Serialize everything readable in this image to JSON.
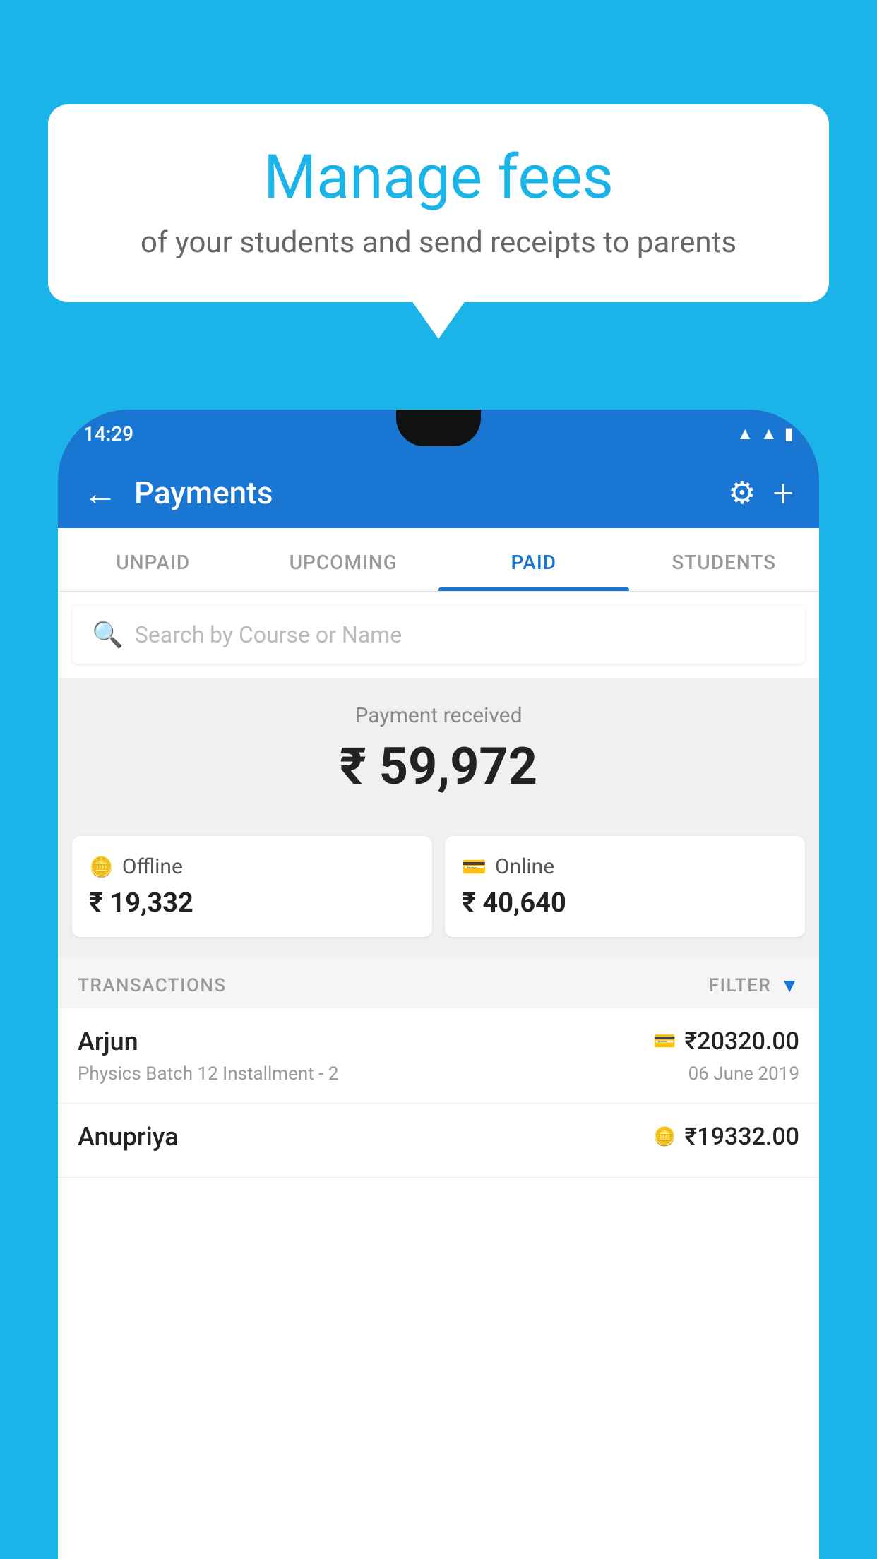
{
  "background_color": "#1ab4e8",
  "bubble": {
    "title": "Manage fees",
    "subtitle": "of your students and send receipts to parents"
  },
  "phone": {
    "status_bar": {
      "time": "14:29",
      "icons": [
        "wifi",
        "signal",
        "battery"
      ]
    },
    "header": {
      "title": "Payments",
      "back_label": "←",
      "gear_label": "⚙",
      "plus_label": "+"
    },
    "tabs": [
      {
        "label": "UNPAID",
        "active": false
      },
      {
        "label": "UPCOMING",
        "active": false
      },
      {
        "label": "PAID",
        "active": true
      },
      {
        "label": "STUDENTS",
        "active": false
      }
    ],
    "search": {
      "placeholder": "Search by Course or Name"
    },
    "payment_section": {
      "received_label": "Payment received",
      "total_amount": "₹ 59,972",
      "offline": {
        "label": "Offline",
        "amount": "₹ 19,332"
      },
      "online": {
        "label": "Online",
        "amount": "₹ 40,640"
      }
    },
    "transactions": {
      "section_label": "TRANSACTIONS",
      "filter_label": "FILTER",
      "rows": [
        {
          "name": "Arjun",
          "amount": "₹20320.00",
          "detail": "Physics Batch 12 Installment - 2",
          "date": "06 June 2019",
          "payment_type": "online"
        },
        {
          "name": "Anupriya",
          "amount": "₹19332.00",
          "detail": "",
          "date": "",
          "payment_type": "offline"
        }
      ]
    }
  }
}
